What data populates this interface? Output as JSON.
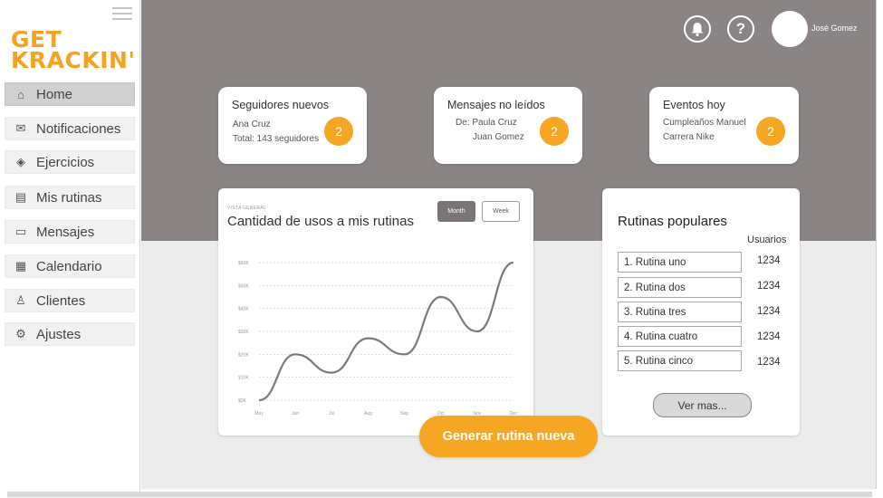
{
  "brand": {
    "logo_line1": "GET",
    "logo_line2": "KRACKIN'",
    "accent": "#f5a623",
    "header_bg": "#8a8584"
  },
  "sidebar": {
    "items": [
      {
        "label": "Home",
        "icon": "home-icon",
        "glyph": "⌂",
        "active": true
      },
      {
        "label": "Notificaciones",
        "icon": "mail-icon",
        "glyph": "✉",
        "active": false
      },
      {
        "label": "Ejercicios",
        "icon": "exercise-diamond-icon",
        "glyph": "◈",
        "active": false
      },
      {
        "label": "Mis rutinas",
        "icon": "document-icon",
        "glyph": "▤",
        "active": false
      },
      {
        "label": "Mensajes",
        "icon": "chat-icon",
        "glyph": "▭",
        "active": false
      },
      {
        "label": "Calendario",
        "icon": "calendar-icon",
        "glyph": "▦",
        "active": false
      },
      {
        "label": "Clientes",
        "icon": "person-icon",
        "glyph": "♙",
        "active": false
      },
      {
        "label": "Ajustes",
        "icon": "gear-icon",
        "glyph": "⚙",
        "active": false
      }
    ]
  },
  "header": {
    "bell_icon": "bell-icon",
    "help_icon": "help-icon",
    "help_glyph": "?",
    "user_name": "José Gomez"
  },
  "stats": [
    {
      "title": "Seguidores nuevos",
      "line1": "Ana Cruz",
      "line2": "Total: 143 seguidores",
      "count": "2"
    },
    {
      "title": "Mensajes no leídos",
      "line1": "De:  Paula Cruz",
      "line2": "Juan Gomez",
      "count": "2"
    },
    {
      "title": "Eventos hoy",
      "line1": "Cumpleaños Manuel",
      "line2": "Carrera Nike",
      "count": "2"
    }
  ],
  "usage_chart": {
    "kicker": "VISTA GENERAL",
    "title": "Cantidad de usos a mis rutinas",
    "toggle_month": "Month",
    "toggle_week": "Week",
    "selected": "Month"
  },
  "chart_data": {
    "type": "line",
    "title": "Cantidad de usos a mis rutinas",
    "x": [
      "May",
      "Jun",
      "Jul",
      "Aug",
      "Sep",
      "Oct",
      "Nov",
      "Dec"
    ],
    "y_ticks": [
      "$0K",
      "$10K",
      "$20K",
      "$30K",
      "$40K",
      "$50K",
      "$60K"
    ],
    "ylim": [
      0,
      60
    ],
    "series": [
      {
        "values": [
          0,
          20,
          12,
          27,
          20,
          45,
          30,
          60
        ],
        "color": "#7d7a79",
        "smooth": true
      }
    ],
    "grid": "horizontal-dotted",
    "legend": "none"
  },
  "popular": {
    "title": "Rutinas populares",
    "column": "Usuarios",
    "rows": [
      {
        "name": "1. Rutina uno",
        "users": "1234"
      },
      {
        "name": "2. Rutina dos",
        "users": "1234"
      },
      {
        "name": "3. Rutina tres",
        "users": "1234"
      },
      {
        "name": "4. Rutina cuatro",
        "users": "1234"
      },
      {
        "name": "5. Rutina cinco",
        "users": "1234"
      }
    ],
    "more_label": "Ver mas..."
  },
  "cta": {
    "label": "Generar rutina nueva"
  }
}
